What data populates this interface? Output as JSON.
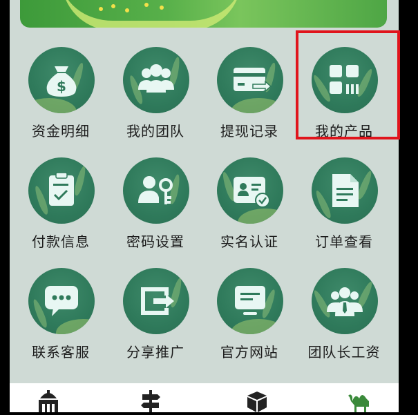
{
  "banner": {
    "description_name": "promo-banner"
  },
  "menu": {
    "items": [
      {
        "label": "资金明细",
        "icon": "money-bag-icon"
      },
      {
        "label": "我的团队",
        "icon": "team-icon"
      },
      {
        "label": "提现记录",
        "icon": "withdraw-card-icon"
      },
      {
        "label": "我的产品",
        "icon": "products-grid-icon"
      },
      {
        "label": "付款信息",
        "icon": "payment-clipboard-icon"
      },
      {
        "label": "密码设置",
        "icon": "user-key-icon"
      },
      {
        "label": "实名认证",
        "icon": "id-card-verify-icon"
      },
      {
        "label": "订单查看",
        "icon": "order-document-icon"
      },
      {
        "label": "联系客服",
        "icon": "chat-bubble-icon"
      },
      {
        "label": "分享推广",
        "icon": "share-arrow-icon"
      },
      {
        "label": "官方网站",
        "icon": "website-icon"
      },
      {
        "label": "团队长工资",
        "icon": "leader-salary-icon"
      }
    ]
  },
  "tabbar": {
    "tabs": [
      {
        "icon": "home-building-icon"
      },
      {
        "icon": "signpost-icon"
      },
      {
        "icon": "box-icon"
      },
      {
        "icon": "camel-icon"
      }
    ]
  },
  "colors": {
    "background": "#cfdad5",
    "icon_circle": "#2f7a5b",
    "highlight": "#e0141c",
    "icon_glyph": "#e8f7f3",
    "active_tab": "#3a8a3a"
  }
}
